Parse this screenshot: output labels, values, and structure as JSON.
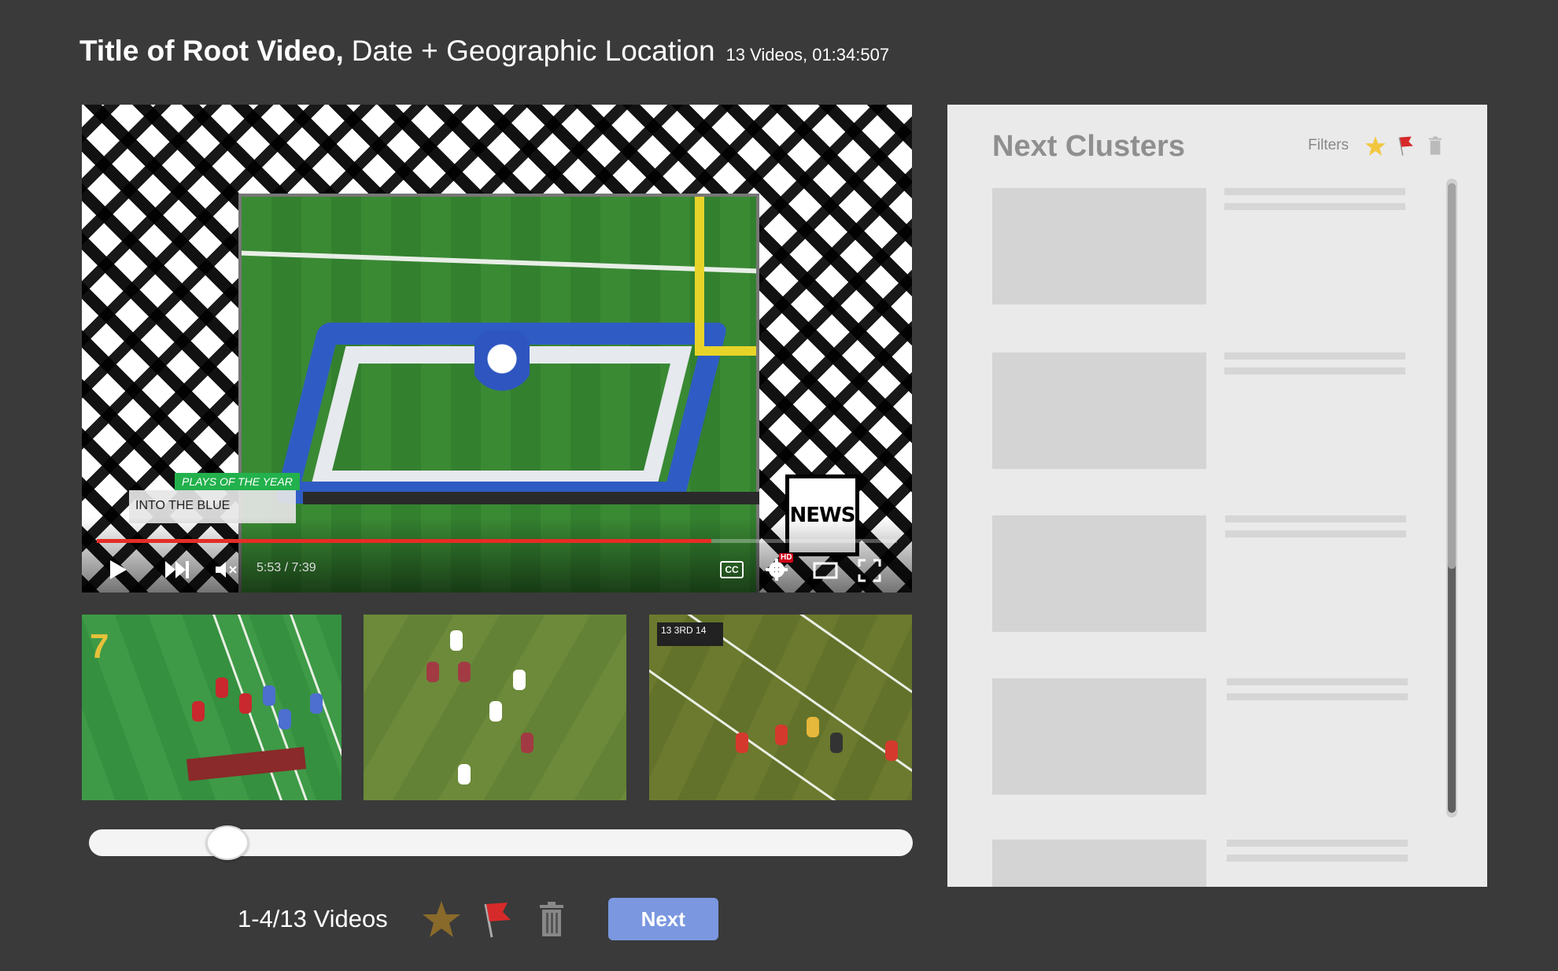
{
  "header": {
    "title": "Title of Root Video,",
    "subtitle": "Date + Geographic Location",
    "meta": "13 Videos, 01:34:507"
  },
  "player": {
    "lower_third_tag": "PLAYS OF THE YEAR",
    "lower_third_text": "INTO THE BLUE",
    "logo_text": "NEWS",
    "time": "5:53 / 7:39",
    "progress_fraction": 0.768,
    "cc_label": "CC",
    "hd_badge": "HD",
    "icons": [
      "play-icon",
      "skip-next-icon",
      "mute-icon",
      "cc-icon",
      "settings-icon",
      "theater-mode-icon",
      "fullscreen-icon"
    ]
  },
  "thumbnails": [
    {
      "scorebug": "",
      "overlay_number": "7"
    },
    {
      "scorebug": ""
    },
    {
      "scorebug": "13 3RD 14"
    }
  ],
  "timeline": {
    "position_fraction": 0.15
  },
  "bottombar": {
    "count": "1-4/13 Videos",
    "next_label": "Next",
    "icons": [
      "star-icon",
      "flag-icon",
      "trash-icon"
    ]
  },
  "panel": {
    "title": "Next Clusters",
    "filters_label": "Filters",
    "filter_icons": [
      "star-icon",
      "flag-icon",
      "trash-icon"
    ],
    "clusters": 5
  },
  "colors": {
    "background": "#3a3a3a",
    "next_button": "#7a97e0",
    "progress": "#e52d27",
    "panel": "#eaeaea"
  }
}
